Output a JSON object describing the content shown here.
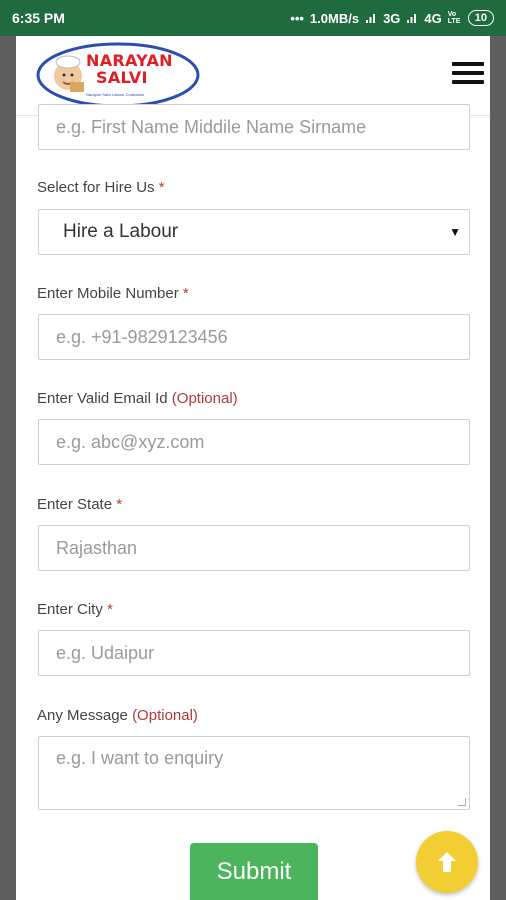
{
  "status_bar": {
    "time": "6:35 PM",
    "dots": "•••",
    "speed": "1.0MB/s",
    "network1": "3G",
    "network2": "4G",
    "volte": "Vo LTE",
    "battery": "10"
  },
  "header": {
    "logo_line1": "NARAYAN",
    "logo_line2": "SALVI",
    "logo_tagline": "Narayan Salvi Labour Contractor",
    "menu_icon": "hamburger-menu-icon"
  },
  "form": {
    "name_placeholder": "e.g. First Name Middile Name Sirname",
    "hire_label": "Select for Hire Us",
    "hire_value": "Hire a Labour",
    "mobile_label": "Enter Mobile Number",
    "mobile_placeholder": "e.g. +91-9829123456",
    "email_label": "Enter Valid Email Id",
    "email_optional": "(Optional)",
    "email_placeholder": "e.g. abc@xyz.com",
    "state_label": "Enter State",
    "state_value": "Rajasthan",
    "city_label": "Enter City",
    "city_placeholder": "e.g. Udaipur",
    "message_label": "Any Message",
    "message_optional": "(Optional)",
    "message_placeholder": "e.g. I want to enquiry",
    "required_mark": "*",
    "submit_label": "Submit"
  },
  "fab": {
    "icon": "arrow-up-icon"
  },
  "colors": {
    "status_bar": "#1f6a3f",
    "submit": "#4cb45c",
    "fab": "#f2cd34",
    "required": "#c0392b"
  }
}
